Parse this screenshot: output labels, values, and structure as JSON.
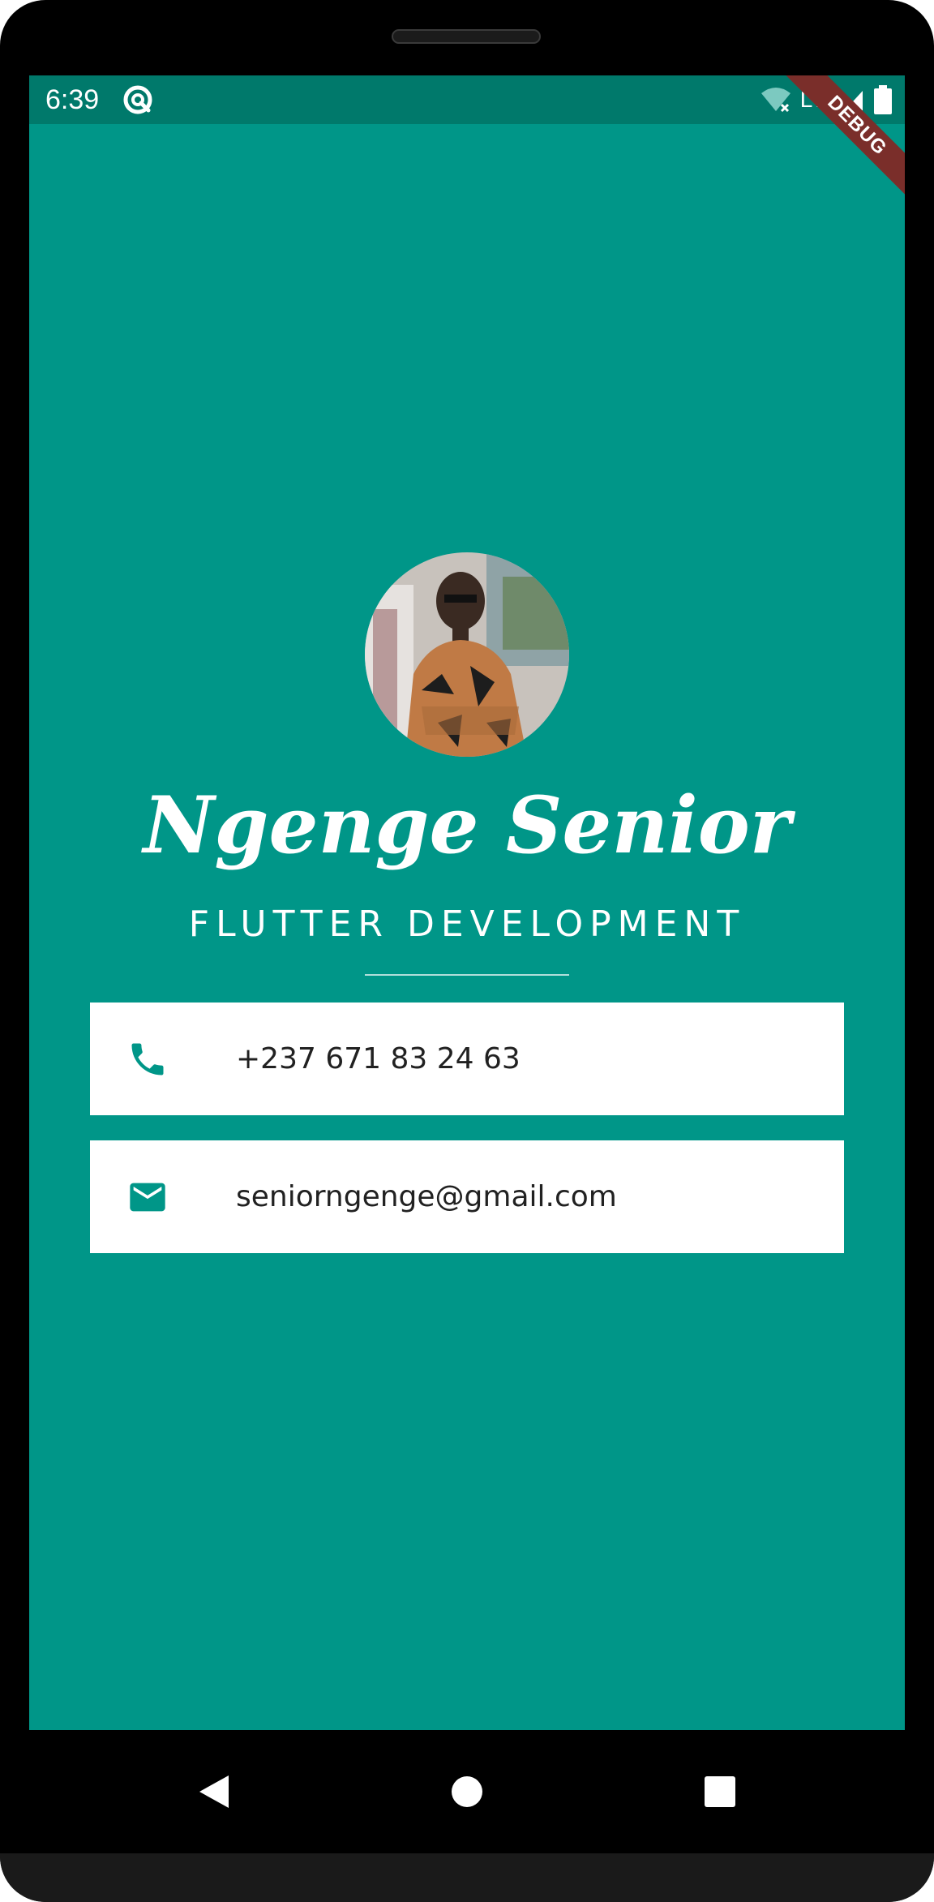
{
  "status_bar": {
    "time": "6:39",
    "network": "LTE",
    "app_icon": "sync-icon"
  },
  "debug_banner": "DEBUG",
  "profile": {
    "avatar_icon": "profile-photo",
    "name": "Ngenge Senior",
    "title": "FLUTTER DEVELOPMENT"
  },
  "contacts": {
    "phone": {
      "icon": "phone-icon",
      "value": "+237 671 83 24 63"
    },
    "email": {
      "icon": "email-icon",
      "value": "seniorngenge@gmail.com"
    }
  },
  "nav": {
    "back_icon": "back-icon",
    "home_icon": "home-icon",
    "recents_icon": "recents-icon"
  },
  "colors": {
    "background": "#009688",
    "status_bar": "#00796b",
    "card": "#ffffff",
    "icon": "#009688",
    "text": "#212121",
    "debug_banner": "#7a2e2a"
  }
}
